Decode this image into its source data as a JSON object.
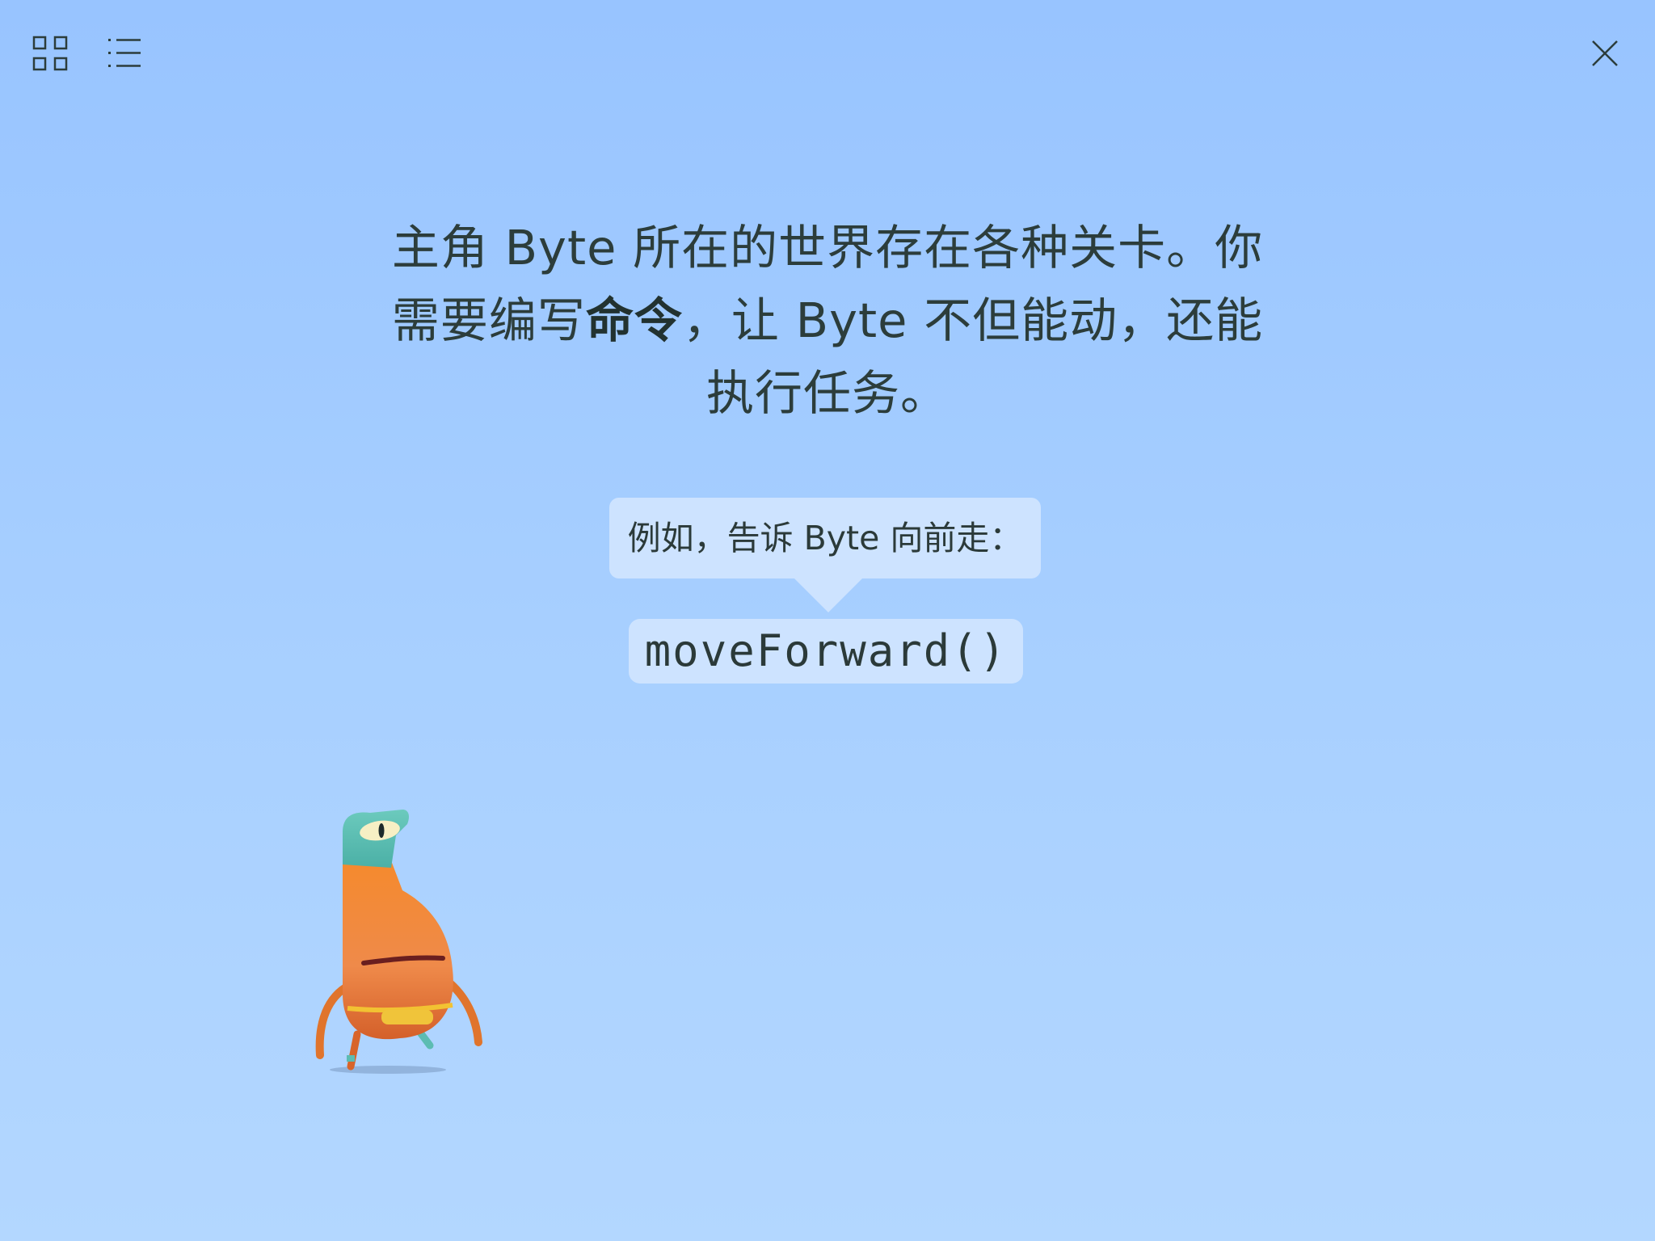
{
  "toolbar": {
    "left_icons": [
      "grid-icon",
      "list-icon"
    ],
    "right_icons": [
      "close-icon"
    ]
  },
  "intro": {
    "line1": "主角 Byte 所在的世界存在各种关卡。你",
    "line2_before": "需要编写",
    "line2_bold": "命令",
    "line2_after": "，让 Byte 不但能动，还能",
    "line3": "执行任务。"
  },
  "example": {
    "bubble_text": "例如，告诉 Byte 向前走：",
    "code": "moveForward()"
  },
  "colors": {
    "background_top": "#98c4ff",
    "background_bottom": "#b3d7ff",
    "bubble": "#cde3ff",
    "text": "#2c3d3b",
    "byte_body": "#f0822a",
    "byte_head": "#5cbcb2"
  },
  "character": {
    "name_icon": "byte-character"
  }
}
